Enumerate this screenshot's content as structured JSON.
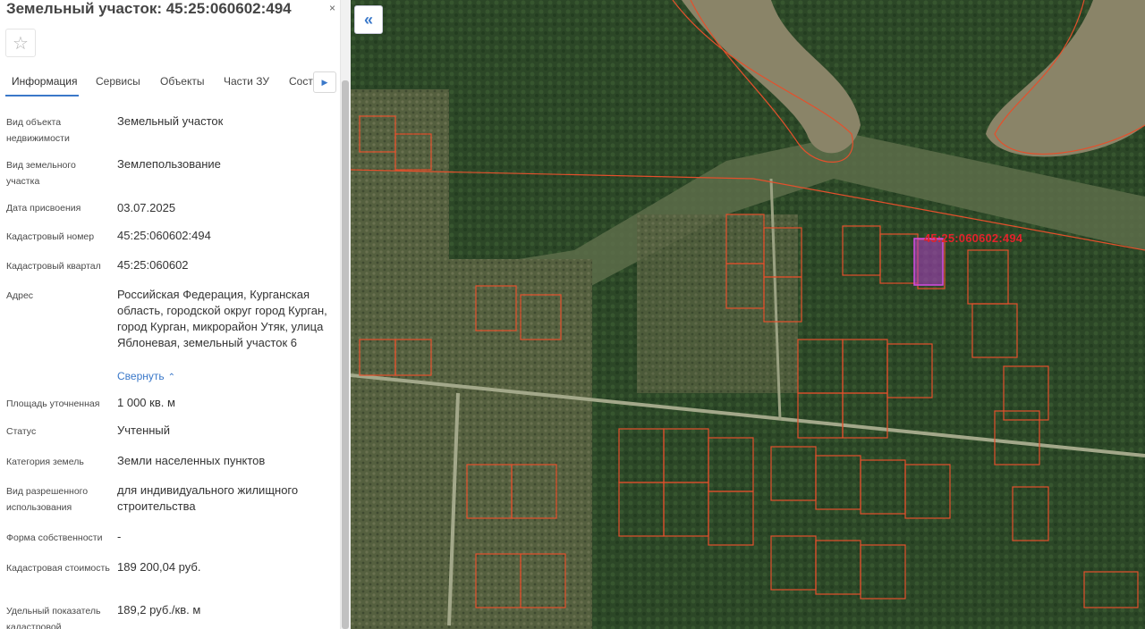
{
  "panel": {
    "title": "Земельный участок: 45:25:060602:494",
    "close_icon": "×",
    "favorite_icon": "star-icon",
    "tabs": [
      "Информация",
      "Сервисы",
      "Объекты",
      "Части ЗУ",
      "Соста..."
    ],
    "active_tab": "Информация",
    "rows": [
      {
        "label": "Вид объекта недвижимости",
        "value": "Земельный участок"
      },
      {
        "label": "Вид земельного участка",
        "value": "Землепользование"
      },
      {
        "label": "Дата присвоения",
        "value": "03.07.2025"
      },
      {
        "label": "Кадастровый номер",
        "value": "45:25:060602:494"
      },
      {
        "label": "Кадастровый квартал",
        "value": "45:25:060602"
      },
      {
        "label": "Адрес",
        "value": "Российская Федерация, Курганская область, городской округ город Курган, город Курган, микрорайон Утяк, улица Яблоневая, земельный участок 6"
      },
      {
        "label": "Площадь уточненная",
        "value": "1 000 кв. м"
      },
      {
        "label": "Статус",
        "value": "Учтенный"
      },
      {
        "label": "Категория земель",
        "value": "Земли населенных пунктов"
      },
      {
        "label": "Вид разрешенного использования",
        "value": "для индивидуального жилищного строительства"
      },
      {
        "label": "Форма собственности",
        "value": "-"
      },
      {
        "label": "Кадастровая стоимость",
        "value": "189 200,04 руб."
      },
      {
        "label": "Удельный показатель кадастровой",
        "value": "189,2 руб./кв. м"
      }
    ],
    "collapse_link": "Свернуть"
  },
  "map": {
    "collapse_button": "«",
    "parcel_label": "45:25:060602:494",
    "colors": {
      "parcel_border": "#e4502c",
      "selected_parcel": "#c43ad0",
      "label": "#e3222b"
    }
  }
}
